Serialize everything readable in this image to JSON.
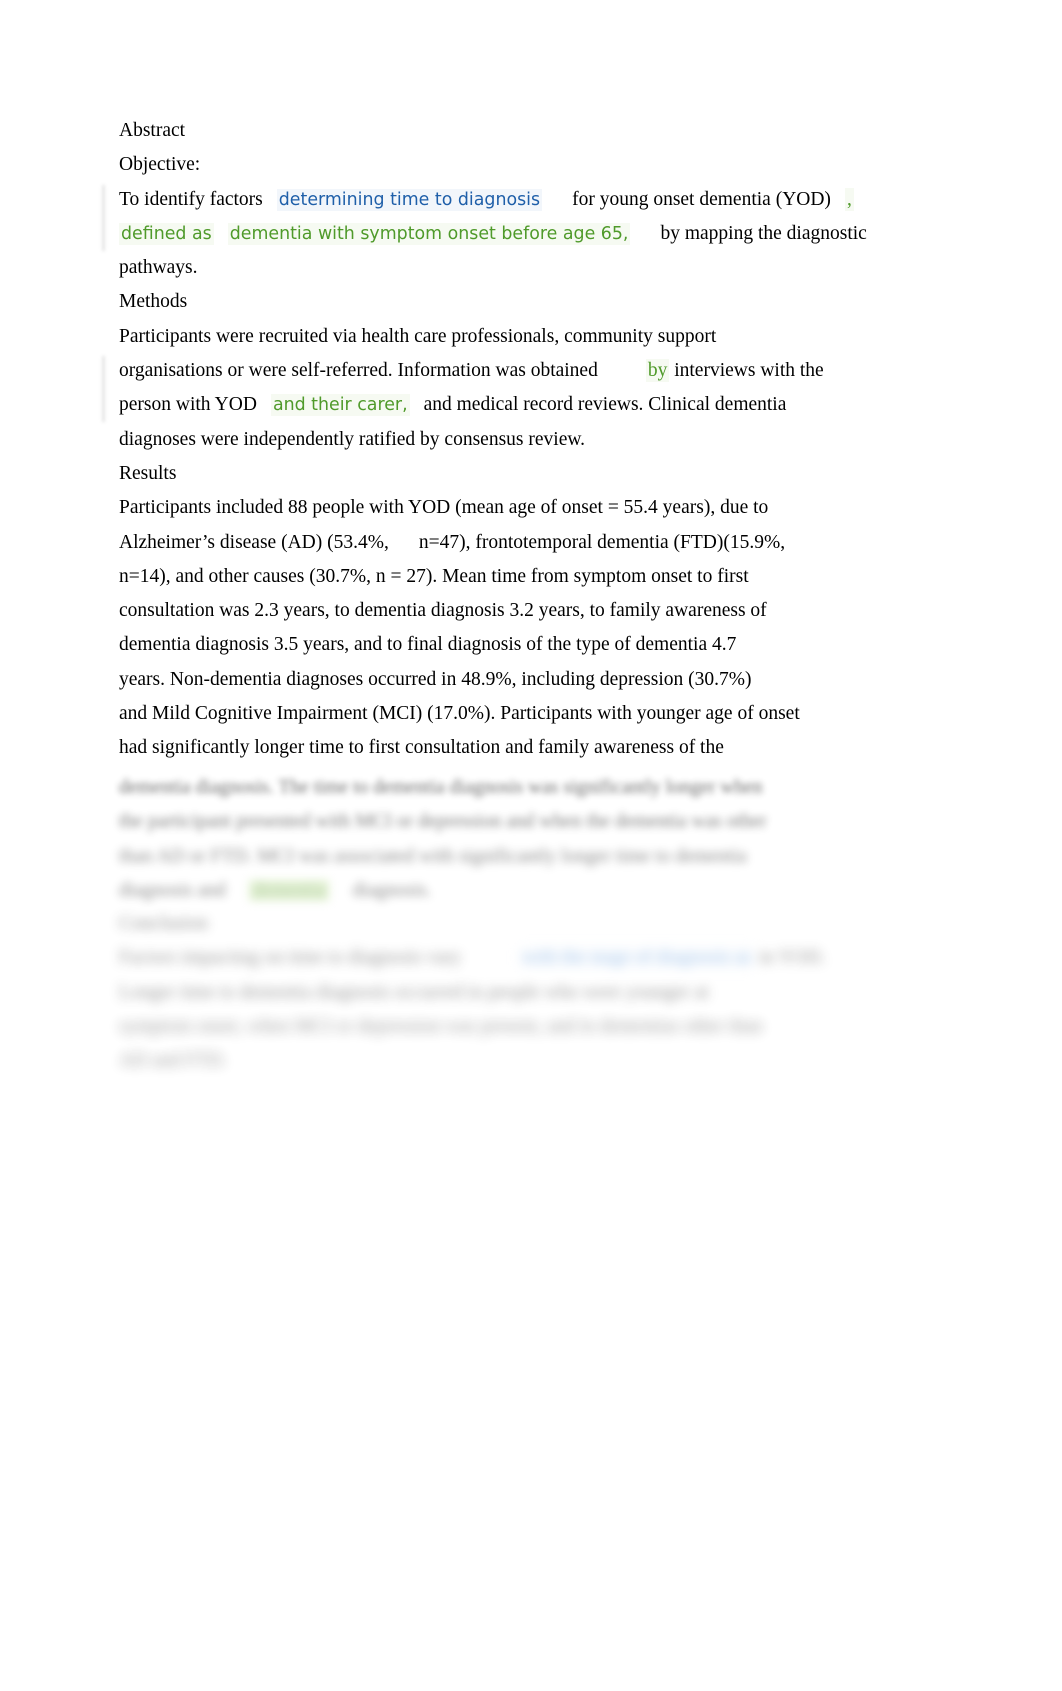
{
  "document": {
    "type": "word-processor-abstract-page",
    "page_background": "#ffffff",
    "text_color": "#000000",
    "insertion_blue": "#1f5fa9",
    "insertion_green": "#4f9a2a",
    "highlight_green": "#cfe8b4"
  },
  "headings": {
    "abstract": "Abstract",
    "objective": "Objective:",
    "methods": "Methods",
    "results": "Results",
    "conclusion": "Conclusion"
  },
  "objective": {
    "line1_a": "To identify factors",
    "line1_ins_blue": "determining time to diagnosis",
    "line1_b": "for young onset dementia (YOD)",
    "line1_ins_green_comma": ",",
    "line2_ins_green_a": "defined as",
    "line2_ins_green_b": "dementia with symptom onset before age 65,",
    "line2_b": "by mapping the diagnostic",
    "line3": "pathways."
  },
  "methods": {
    "line1": "Participants were recruited via health care professionals, community support",
    "line2_a": "organisations or were self-referred. Information was obtained",
    "line2_ins_green": "by",
    "line2_b": "interviews with the",
    "line3_a": "person with YOD",
    "line3_ins_green": "and their carer,",
    "line3_b": "and medical record reviews. Clinical dementia",
    "line4": "diagnoses were independently ratified by consensus review."
  },
  "results": {
    "line1": "Participants included 88 people with YOD (mean age of onset = 55.4 years), due to",
    "line2_a": "Alzheimer’s disease (AD) (53.4%,",
    "line2_b": "n=47), frontotemporal dementia (FTD)(15.9%,",
    "line3": "n=14), and other causes (30.7%, n = 27). Mean time from symptom onset to first",
    "line4": "consultation was 2.3 years, to dementia diagnosis 3.2 years, to family awareness of",
    "line5": "dementia diagnosis 3.5 years, and to final diagnosis of the type of dementia 4.7",
    "line6": "years. Non-dementia diagnoses occurred in 48.9%, including depression (30.7%)",
    "line7": "and Mild Cognitive Impairment (MCI) (17.0%). Participants with younger age of onset",
    "line8": "had significantly longer time to first consultation and family awareness of the"
  },
  "blurred_results": {
    "line1": "dementia diagnosis. The time to dementia diagnosis was significantly longer when",
    "line2": "the participant presented with MCI or depression and when the dementia was other",
    "line3": "than AD or FTD. MCI was associated with significantly longer time to dementia",
    "line4_a": "diagnosis and",
    "line4_highlight": "dementia",
    "line4_b": "diagnosis."
  },
  "blurred_conclusion": {
    "heading": "Conclusion",
    "line1_a": "Factors impacting on time to diagnosis vary",
    "line1_blue": "with the stage of  diagnosis as",
    "line1_b": "in YOD.",
    "line2": "Longer time to dementia diagnosis occurred in people who were younger at",
    "line3": "symptom onset, when MCI or depression was present, and in dementias other than",
    "line4": "AD and FTD."
  }
}
